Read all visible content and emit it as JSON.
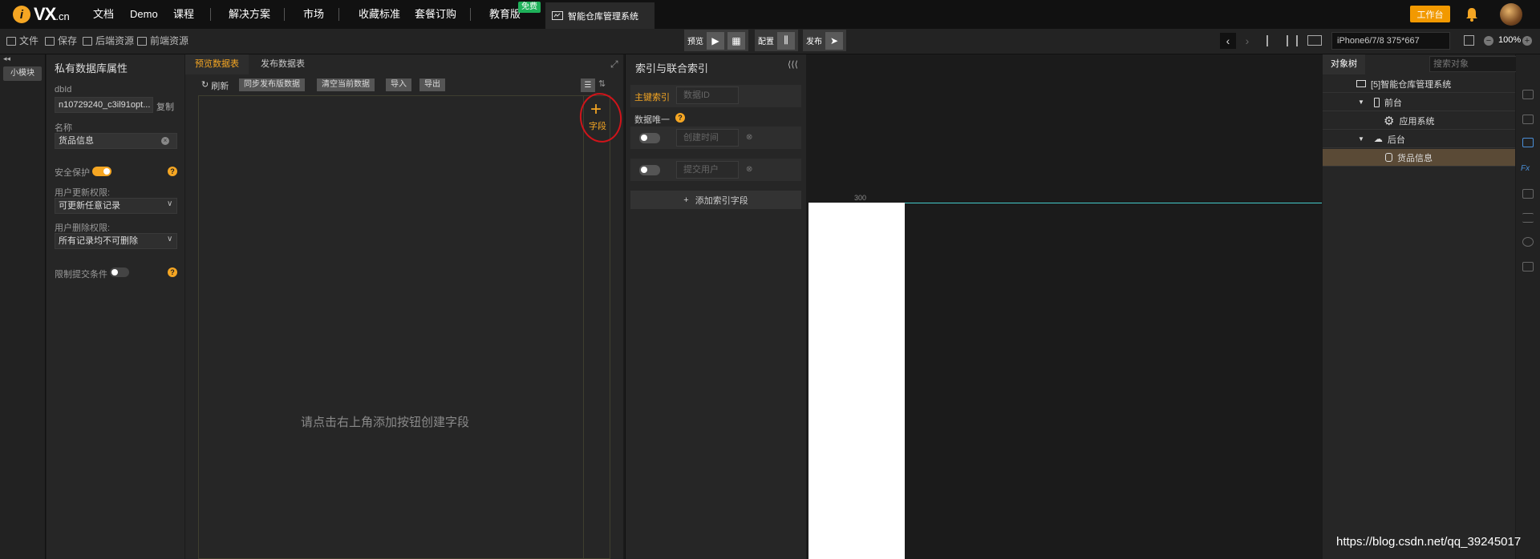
{
  "topnav": {
    "logo": "VX",
    "logo_suffix": ".cn",
    "items": [
      "文档",
      "Demo",
      "课程",
      "解决方案",
      "市场",
      "收藏标准",
      "套餐订购",
      "教育版"
    ],
    "badge": "免费",
    "app_tab": "智能仓库管理系统",
    "workbench": "工作台"
  },
  "toolbar": {
    "file": "文件",
    "save": "保存",
    "backend_res": "后端资源",
    "frontend_res": "前端资源",
    "preview": "预览",
    "config": "配置",
    "publish": "发布",
    "device": "iPhone6/7/8 375*667",
    "zoom": "100%"
  },
  "left": {
    "module_tag": "小模块"
  },
  "props": {
    "title": "私有数据库属性",
    "dbid_label": "dbId",
    "dbid_value": "n10729240_c3il91opt...",
    "copy": "复制",
    "name_label": "名称",
    "name_value": "货品信息",
    "security_label": "安全保护",
    "update_perm_label": "用户更新权限:",
    "update_perm_value": "可更新任意记录",
    "delete_perm_label": "用户删除权限:",
    "delete_perm_value": "所有记录均不可删除",
    "limit_label": "限制提交条件"
  },
  "data": {
    "tabs": [
      "预览数据表",
      "发布数据表"
    ],
    "refresh": "刷新",
    "sync": "同步发布版数据",
    "clear": "清空当前数据",
    "import": "导入",
    "export": "导出",
    "add_field": "字段",
    "empty_hint": "请点击右上角添加按钮创建字段"
  },
  "index": {
    "title": "索引与联合索引",
    "primary": "主键索引",
    "primary_field": "数据ID",
    "unique_label": "数据唯一",
    "field1": "创建时间",
    "field2": "提交用户",
    "add": "添加索引字段"
  },
  "canvas": {
    "ruler": "300"
  },
  "tree": {
    "tab": "对象树",
    "search_placeholder": "搜索对象",
    "nodes": [
      "[5]智能仓库管理系统",
      "前台",
      "应用系统",
      "后台",
      "货品信息"
    ]
  },
  "watermark": "https://blog.csdn.net/qq_39245017",
  "colors": {
    "accent": "#f5a623",
    "selected": "#5a4a36",
    "annotation": "#d0141a"
  }
}
